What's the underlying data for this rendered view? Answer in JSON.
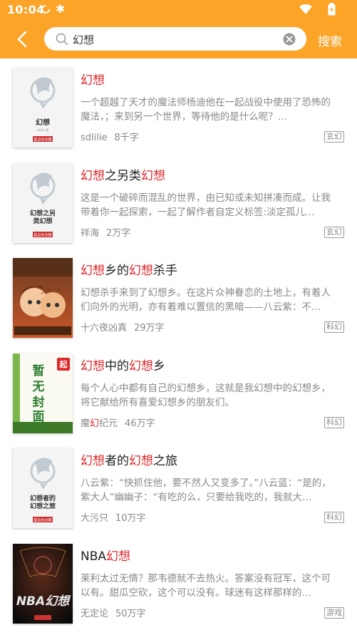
{
  "status_bar": {
    "time": "10:04"
  },
  "search": {
    "query": "幻想",
    "action_label": "搜索"
  },
  "books": [
    {
      "title": [
        {
          "t": "幻想",
          "hl": true
        }
      ],
      "desc": "一个超越了天才的魔法师杨迪他在一起战役中使用了恐怖的魔法，；来到另一个世界，等待他的是什么呢？…",
      "author": [
        {
          "t": "sdlilie",
          "hl": false
        }
      ],
      "words": "8千字",
      "tag": "玄幻",
      "cover_title": "幻想",
      "cover_style": "default"
    },
    {
      "title": [
        {
          "t": "幻想",
          "hl": true
        },
        {
          "t": "之另类",
          "hl": false
        },
        {
          "t": "幻想",
          "hl": true
        }
      ],
      "desc": "这是一个破碎而混乱的世界，由已知或未知拼凑而成。让我带着你一起探索，一起了解作者自定义标签:淡定孤儿…",
      "author": [
        {
          "t": "祥海",
          "hl": false
        }
      ],
      "words": "2万字",
      "tag": "玄幻",
      "cover_title": "幻想之另类幻想",
      "cover_style": "default"
    },
    {
      "title": [
        {
          "t": "幻想",
          "hl": true
        },
        {
          "t": "乡的",
          "hl": false
        },
        {
          "t": "幻想",
          "hl": true
        },
        {
          "t": "杀手",
          "hl": false
        }
      ],
      "desc": "幻想杀手来到了幻想乡。在这片众神眷恋的土地上，有着人们向外的光明，亦有着难以置信的黑暗——八云紫：不…",
      "author": [
        {
          "t": "十六夜凶真",
          "hl": false
        }
      ],
      "words": "29万字",
      "tag": "科幻",
      "cover_title": "",
      "cover_style": "anime"
    },
    {
      "title": [
        {
          "t": "幻想",
          "hl": true
        },
        {
          "t": "中的",
          "hl": false
        },
        {
          "t": "幻想",
          "hl": true
        },
        {
          "t": "乡",
          "hl": false
        }
      ],
      "desc": "每个人心中都有自己的幻想乡，这就是我幻想中的幻想乡，将它献给所有喜爱幻想乡的朋友们。",
      "author": [
        {
          "t": "魔",
          "hl": false
        },
        {
          "t": "幻",
          "hl": true
        },
        {
          "t": "纪元",
          "hl": false
        }
      ],
      "words": "46万字",
      "tag": "科幻",
      "cover_title": "暂无封面",
      "cover_style": "green"
    },
    {
      "title": [
        {
          "t": "幻想",
          "hl": true
        },
        {
          "t": "者的",
          "hl": false
        },
        {
          "t": "幻想",
          "hl": true
        },
        {
          "t": "之旅",
          "hl": false
        }
      ],
      "desc": "八云紫：“快抓住他，要不然人又变多了。”八云蓝：“是的，紫大人”幽幽子：“有吃的么，只要给我吃的，我就大…",
      "author": [
        {
          "t": "大污只",
          "hl": false
        }
      ],
      "words": "10万字",
      "tag": "科幻",
      "cover_title": "幻想者的幻想之旅",
      "cover_style": "default"
    },
    {
      "title": [
        {
          "t": "NBA",
          "hl": false
        },
        {
          "t": "幻想",
          "hl": true
        }
      ],
      "desc": "莱利太过无情？那韦德就不去热火。答案没有冠军，这个可以有。甜瓜空砍，这个可以没有。球迷有这样那样的…",
      "author": [
        {
          "t": "无定论",
          "hl": false
        }
      ],
      "words": "50万字",
      "tag": "游戏",
      "cover_title": "NBA幻想",
      "cover_style": "nba"
    }
  ],
  "colors": {
    "header": "#fba428",
    "highlight": "#e0262a"
  },
  "icons": {
    "back": "chevron-left-icon",
    "search": "search-icon",
    "clear": "clear-icon"
  }
}
